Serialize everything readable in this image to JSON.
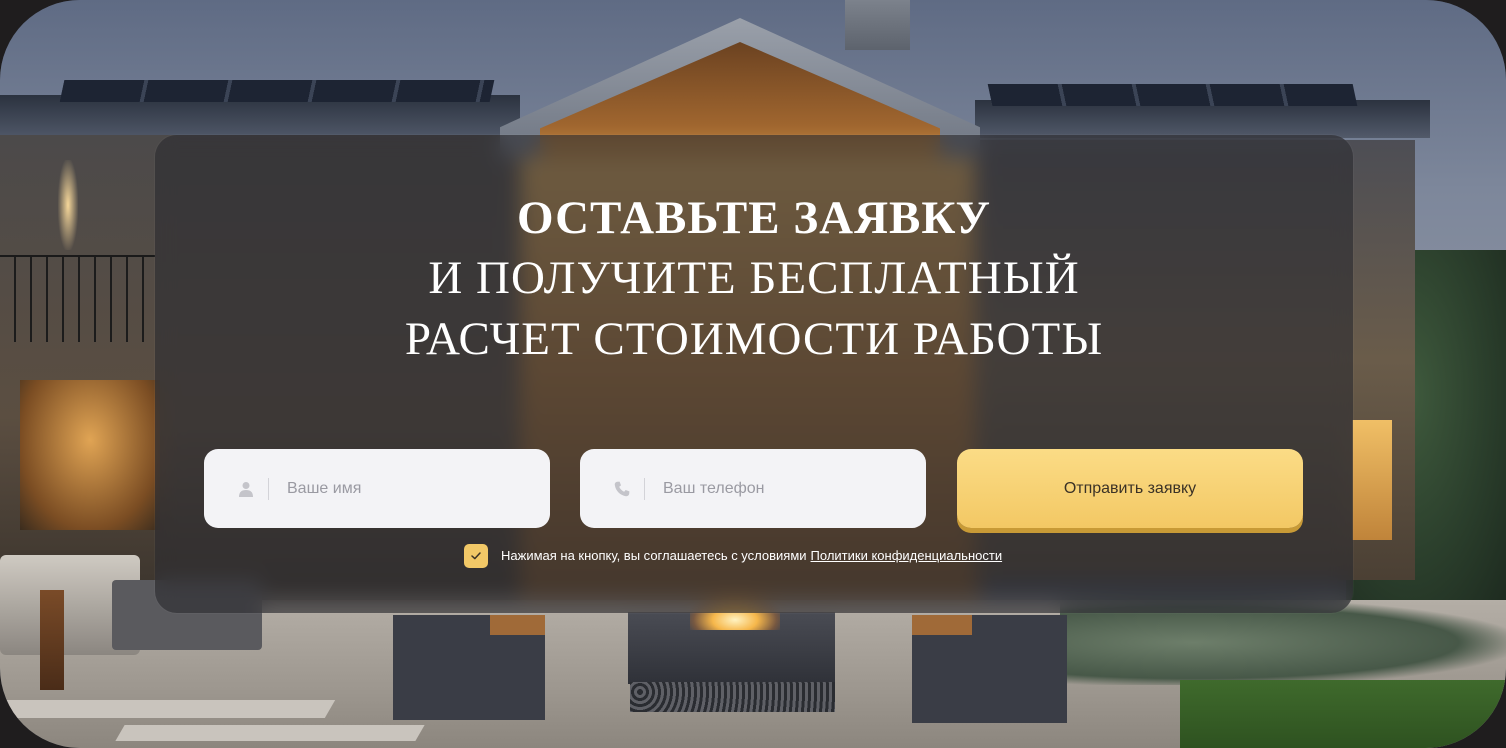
{
  "headline": {
    "line1": "Оставьте заявку",
    "line2": "и получите бесплатный",
    "line3": "расчет стоимости работы"
  },
  "form": {
    "name_field": {
      "placeholder": "Ваше имя",
      "value": "",
      "icon": "user-icon"
    },
    "phone_field": {
      "placeholder": "Ваш телефон",
      "value": "",
      "icon": "phone-icon"
    },
    "submit_label": "Отправить заявку",
    "consent": {
      "checked": true,
      "text": "Нажимая на кнопку, вы соглашаетесь с условиями",
      "link_label": "Политики конфиденциальности"
    }
  },
  "colors": {
    "accent": "#f3c864",
    "panel": "#2c2c30",
    "field_bg": "#f3f3f6",
    "text_light": "#ffffff"
  }
}
